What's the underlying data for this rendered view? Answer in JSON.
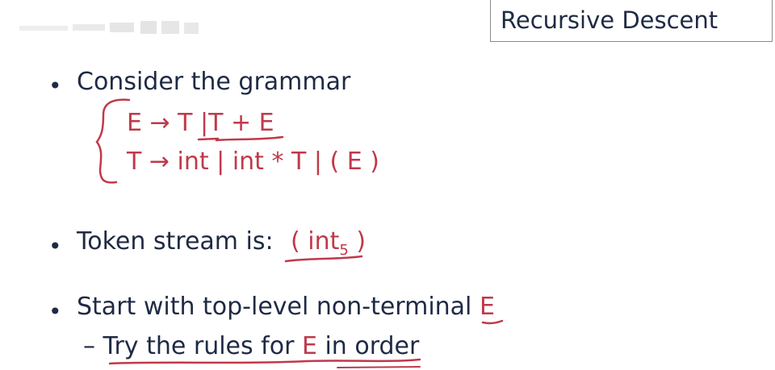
{
  "slide_title": "Recursive Descent",
  "bullets": {
    "b1_text": "Consider the grammar",
    "b2_text": "Token stream is:",
    "b3_text": "Start with top-level non-terminal",
    "b3_nonterminal": "E",
    "sub1_dash": "–",
    "sub1_text_a": "Try the rules for ",
    "sub1_text_e": "E",
    "sub1_text_b": " in order"
  },
  "grammar": {
    "line1": "E → T |T + E",
    "line2": "T → int  | int * T | ( E )"
  },
  "token_stream": {
    "open": "( int",
    "subscript": "5",
    "close": " )"
  },
  "colors": {
    "text": "#1f2a44",
    "annotation_red": "#c0394b"
  }
}
